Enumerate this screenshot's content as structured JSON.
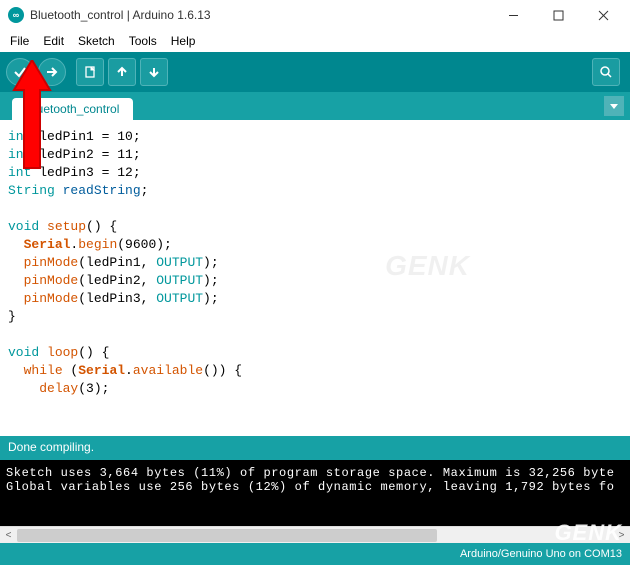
{
  "titlebar": {
    "title": "Bluetooth_control | Arduino 1.6.13"
  },
  "menu": {
    "file": "File",
    "edit": "Edit",
    "sketch": "Sketch",
    "tools": "Tools",
    "help": "Help"
  },
  "tab": {
    "name": "Bluetooth_control"
  },
  "code": {
    "l1_type": "int",
    "l1_rest": " ledPin1 = 10;",
    "l2_type": "int",
    "l2_rest": " ledPin2 = 11;",
    "l3_type": "int",
    "l3_rest": " ledPin3 = 12;",
    "l4_type": "String",
    "l4_var": " readString",
    "l4_end": ";",
    "l6_void": "void",
    "l6_func": " setup",
    "l6_rest": "() {",
    "l7_ind": "  ",
    "l7_obj": "Serial",
    "l7_dot": ".",
    "l7_func": "begin",
    "l7_rest": "(9600);",
    "l8_ind": "  ",
    "l8_func": "pinMode",
    "l8_open": "(ledPin1, ",
    "l8_const": "OUTPUT",
    "l8_close": ");",
    "l9_ind": "  ",
    "l9_func": "pinMode",
    "l9_open": "(ledPin2, ",
    "l9_const": "OUTPUT",
    "l9_close": ");",
    "l10_ind": "  ",
    "l10_func": "pinMode",
    "l10_open": "(ledPin3, ",
    "l10_const": "OUTPUT",
    "l10_close": ");",
    "l11": "}",
    "l13_void": "void",
    "l13_func": " loop",
    "l13_rest": "() {",
    "l14_ind": "  ",
    "l14_func": "while",
    "l14_open": " (",
    "l14_obj": "Serial",
    "l14_dot": ".",
    "l14_func2": "available",
    "l14_rest": "()) {",
    "l15_ind": "    ",
    "l15_func": "delay",
    "l15_rest": "(3);"
  },
  "status": {
    "text": "Done compiling."
  },
  "console": {
    "line1": "Sketch uses 3,664 bytes (11%) of program storage space. Maximum is 32,256 byte",
    "line2": "Global variables use 256 bytes (12%) of dynamic memory, leaving 1,792 bytes fo"
  },
  "footer": {
    "board": "Arduino/Genuino Uno on COM13"
  },
  "watermark": {
    "text": "GENK"
  }
}
